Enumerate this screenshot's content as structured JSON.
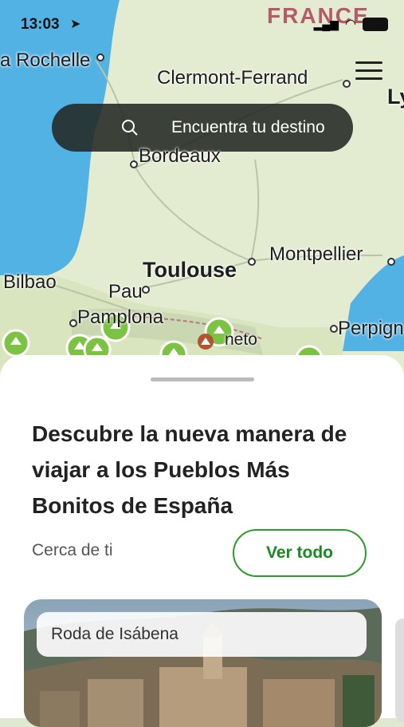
{
  "status": {
    "time": "13:03"
  },
  "map": {
    "labels": {
      "country": "FRANCE",
      "la_rochelle": "a Rochelle",
      "clermont": "Clermont-Ferrand",
      "lyon": "Ly",
      "bordeaux": "Bordeaux",
      "toulouse": "Toulouse",
      "montpellier": "Montpellier",
      "bilbao": "Bilbao",
      "pau": "Pau",
      "pamplona": "Pamplona",
      "perpignan": "Perpign",
      "aneto": "neto"
    }
  },
  "search": {
    "placeholder": "Encuentra tu destino"
  },
  "sheet": {
    "headline": "Descubre la nueva manera de viajar a los Pueblos Más Bonitos de España",
    "near_label": "Cerca de ti",
    "view_all": "Ver todo",
    "card_title": "Roda de Isábena"
  },
  "colors": {
    "accent": "#198a1f",
    "sea": "#53b2e4",
    "land": "#e4ecd2"
  }
}
